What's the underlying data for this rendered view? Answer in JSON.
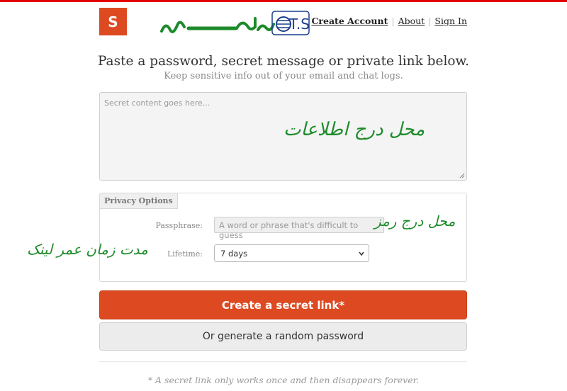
{
  "header": {
    "logo_letter": "S",
    "brand_persian": "تهران سرور",
    "brand_ts": "T.S",
    "accent_color": "#dd4a22",
    "top_bar_color": "#e40000"
  },
  "nav": {
    "create_account": "Create Account",
    "about": "About",
    "sign_in": "Sign In"
  },
  "main": {
    "headline": "Paste a password, secret message or private link below.",
    "subline": "Keep sensitive info out of your email and chat logs.",
    "secret_placeholder": "Secret content goes here..."
  },
  "annotations": {
    "content_area": "محل درج اطلاعات",
    "passphrase": "محل درج رمز",
    "lifetime": "مدت زمان عمر لینک"
  },
  "privacy": {
    "title": "Privacy Options",
    "passphrase_label": "Passphrase:",
    "passphrase_placeholder": "A word or phrase that's difficult to guess",
    "lifetime_label": "Lifetime:",
    "lifetime_value": "7 days"
  },
  "actions": {
    "create_link": "Create a secret link*",
    "random_password": "Or generate a random password"
  },
  "footer": {
    "note": "* A secret link only works once and then disappears forever."
  }
}
